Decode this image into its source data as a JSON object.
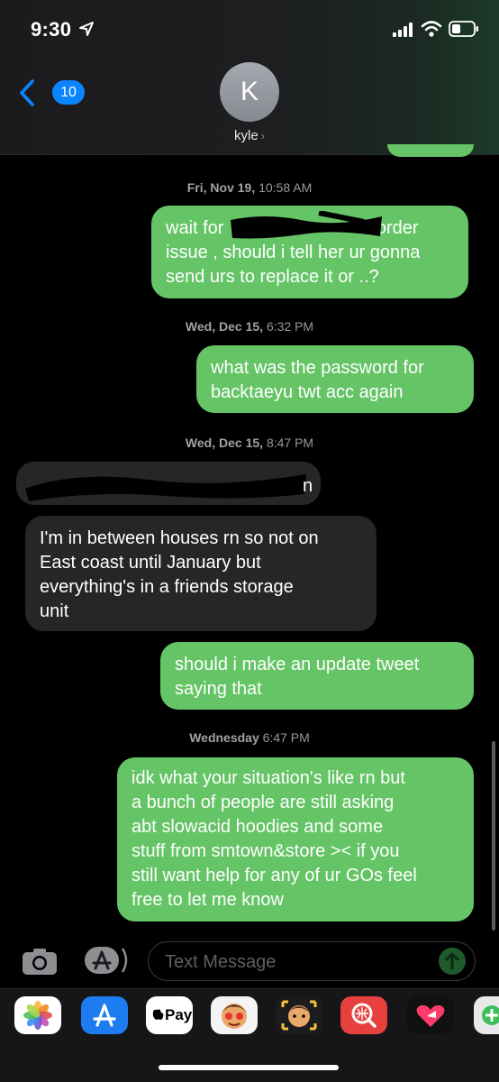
{
  "status_bar": {
    "time": "9:30"
  },
  "header": {
    "back_count": "10",
    "avatar_initial": "K",
    "contact_name": "kyle"
  },
  "messages": [
    {
      "type": "timestamp",
      "day": "Fri, Nov 19,",
      "time": "10:58 AM"
    },
    {
      "type": "sent",
      "lines": [
        "wait for",
        "'s order",
        "issue , should i tell her ur gonna",
        "send urs to replace it or ..?"
      ]
    },
    {
      "type": "timestamp",
      "day": "Wed, Dec 15,",
      "time": "6:32 PM"
    },
    {
      "type": "sent",
      "lines": [
        "what was the password for",
        "backtaeyu twt acc again"
      ]
    },
    {
      "type": "timestamp",
      "day": "Wed, Dec 15,",
      "time": "8:47 PM"
    },
    {
      "type": "received",
      "lines": [
        "n"
      ]
    },
    {
      "type": "received",
      "lines": [
        "I'm in between houses rn so not on",
        "East coast until January but",
        "everything's in a friends storage",
        "unit"
      ]
    },
    {
      "type": "sent",
      "lines": [
        "should i make an update tweet",
        "saying that"
      ]
    },
    {
      "type": "timestamp",
      "day": "Wednesday",
      "time": "6:47 PM"
    },
    {
      "type": "sent",
      "lines": [
        "idk what your situation's like rn but",
        "a bunch of people are still asking",
        "abt slowacid hoodies and some",
        "stuff from smtown&store >< if you",
        "still want help for any of ur GOs feel",
        "free to let me know"
      ]
    }
  ],
  "composer": {
    "placeholder": "Text Message"
  },
  "app_drawer": {
    "apps": [
      "photos-icon",
      "app-store-icon",
      "apple-pay-icon",
      "memoji-icon",
      "memoji-stickers-icon",
      "search-images-icon",
      "digital-touch-icon",
      "more-apps-icon"
    ],
    "apple_pay_label": "Pay"
  },
  "colors": {
    "sent_bubble": "#65c466",
    "received_bubble": "#262628",
    "accent": "#0a84ff"
  }
}
